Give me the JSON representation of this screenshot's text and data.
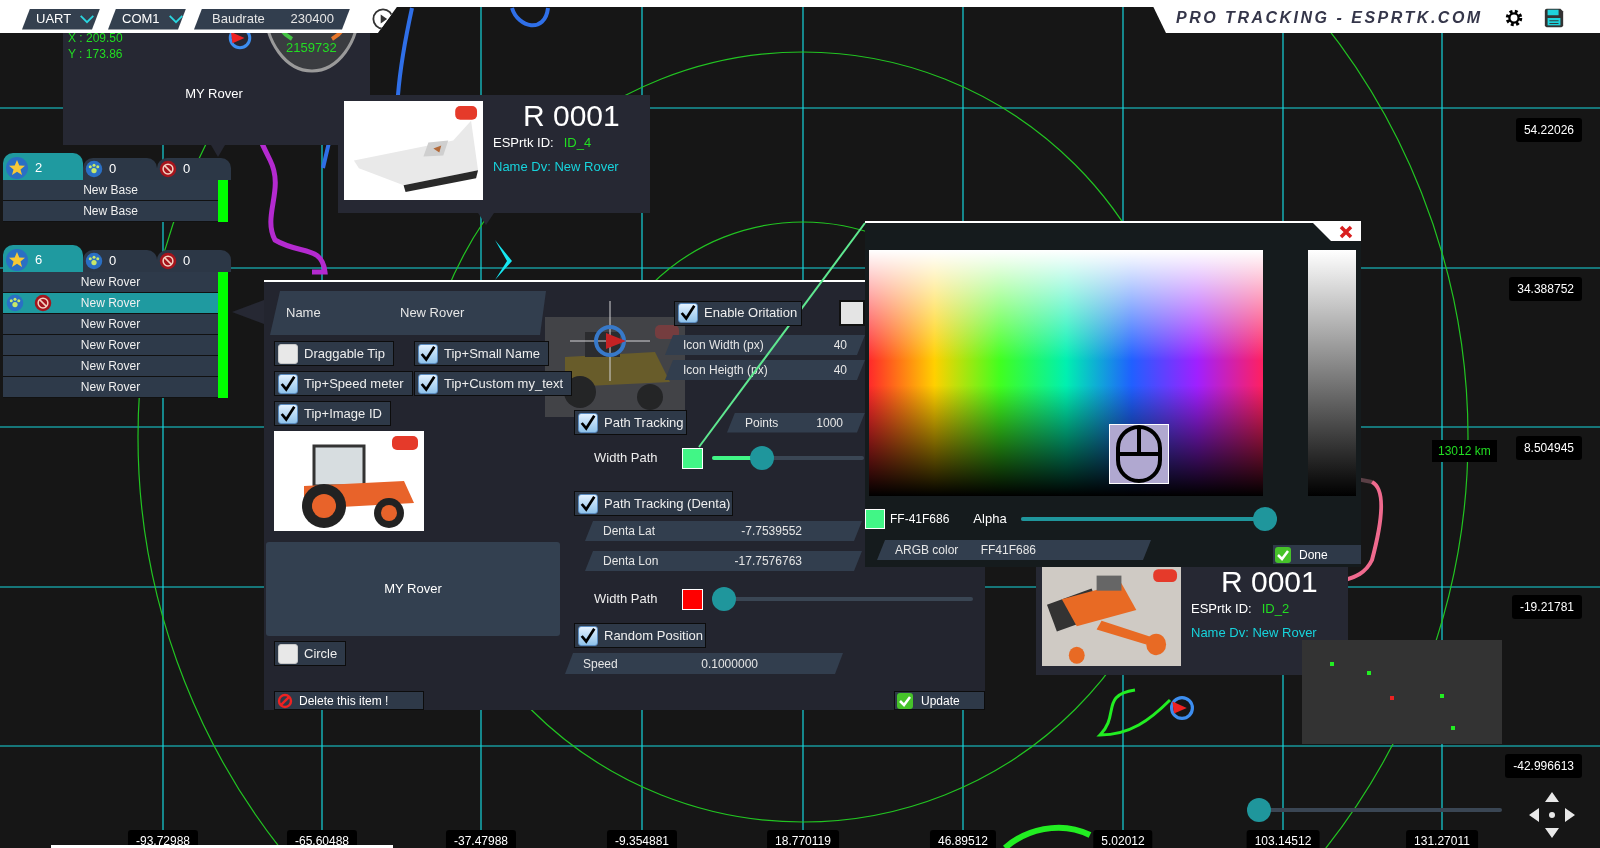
{
  "toolbar": {
    "selectors": [
      {
        "kind": "dropdown",
        "label": "UART"
      },
      {
        "kind": "dropdown",
        "label": "COM1"
      },
      {
        "kind": "field",
        "label": "Baudrate",
        "value": "230400"
      }
    ],
    "brand": "PRO TRACKING - ESPRTK.COM"
  },
  "rover_tip": {
    "coords": [
      "X : 209.50",
      "Y : 173.86"
    ],
    "speed": "2159732",
    "caption": "MY Rover"
  },
  "lists": [
    {
      "tabs": [
        {
          "kind": "star",
          "count": "2",
          "selected": true
        },
        {
          "kind": "globe",
          "count": "0",
          "selected": false
        },
        {
          "kind": "stop",
          "count": "0",
          "selected": false
        }
      ],
      "rows": [
        {
          "label": "New Base",
          "selected": false
        },
        {
          "label": "New Base",
          "selected": false
        }
      ]
    },
    {
      "tabs": [
        {
          "kind": "star",
          "count": "6",
          "selected": true
        },
        {
          "kind": "globe",
          "count": "0",
          "selected": false
        },
        {
          "kind": "stop",
          "count": "0",
          "selected": false
        }
      ],
      "rows": [
        {
          "label": "New Rover",
          "selected": false
        },
        {
          "label": "New Rover",
          "selected": true
        },
        {
          "label": "New Rover",
          "selected": false
        },
        {
          "label": "New Rover",
          "selected": false
        },
        {
          "label": "New Rover",
          "selected": false
        },
        {
          "label": "New Rover",
          "selected": false
        }
      ]
    }
  ],
  "device_cards": [
    {
      "kind": "drone",
      "title": "R 0001",
      "id_label": "ESPrtk ID:",
      "id": "ID_4",
      "name": "Name Dv: New Rover"
    },
    {
      "kind": "crawler",
      "title": "R 0001",
      "id_label": "ESPrtk ID:",
      "id": "ID_2",
      "name": "Name Dv: New Rover"
    }
  ],
  "y_axis": [
    "54.22026",
    "34.388752",
    "8.504945",
    "-19.21781",
    "-42.996613"
  ],
  "x_axis": [
    "-93.72988",
    "-65.60488",
    "-37.47988",
    "-9.354881",
    "18.770119",
    "46.89512",
    "5.02012",
    "103.14512",
    "131.27011"
  ],
  "distance": "13012 km",
  "settings": {
    "name": {
      "label": "Name",
      "value": "New Rover"
    },
    "options": [
      {
        "label": "Draggable Tip",
        "checked": false
      },
      {
        "label": "Tip+Small Name",
        "checked": true
      },
      {
        "label": "Tip+Speed meter",
        "checked": true
      },
      {
        "label": "Tip+Custom my_text",
        "checked": true
      },
      {
        "label": "Tip+Image ID",
        "checked": true
      }
    ],
    "caption": "MY Rover",
    "circle": {
      "label": "Circle",
      "checked": false
    },
    "delete": "Delete this item !",
    "orientation": {
      "label": "Enable Oritation",
      "checked": true
    },
    "extra": {
      "checked": false
    },
    "icon_size": [
      {
        "label": "Icon Width (px)",
        "value": "40"
      },
      {
        "label": "Icon Heigth (px)",
        "value": "40"
      }
    ],
    "path_tracking": {
      "check": {
        "label": "Path Tracking",
        "checked": true
      },
      "points": {
        "label": "Points",
        "value": "1000"
      },
      "width": {
        "label": "Width Path",
        "color": "#41f686",
        "level": 0.3
      }
    },
    "denta": {
      "check": {
        "label": "Path Tracking (Denta)",
        "checked": true
      },
      "fields": [
        {
          "label": "Denta Lat",
          "value": "-7.7539552"
        },
        {
          "label": "Denta Lon",
          "value": "-17.7576763"
        }
      ],
      "width": {
        "label": "Width Path",
        "color": "#ff0000",
        "level": 0
      }
    },
    "random": {
      "check": {
        "label": "Random Position",
        "checked": true
      },
      "speed": {
        "label": "Speed",
        "value": "0.1000000"
      }
    },
    "update": "Update"
  },
  "color_picker": {
    "color": "#41f686",
    "hex": "FF-41F686",
    "alpha": {
      "label": "Alpha",
      "level": 1
    },
    "argb": {
      "label": "ARGB color",
      "value": "FF41F686"
    },
    "done": "Done"
  },
  "zoom": {
    "level": 0
  }
}
